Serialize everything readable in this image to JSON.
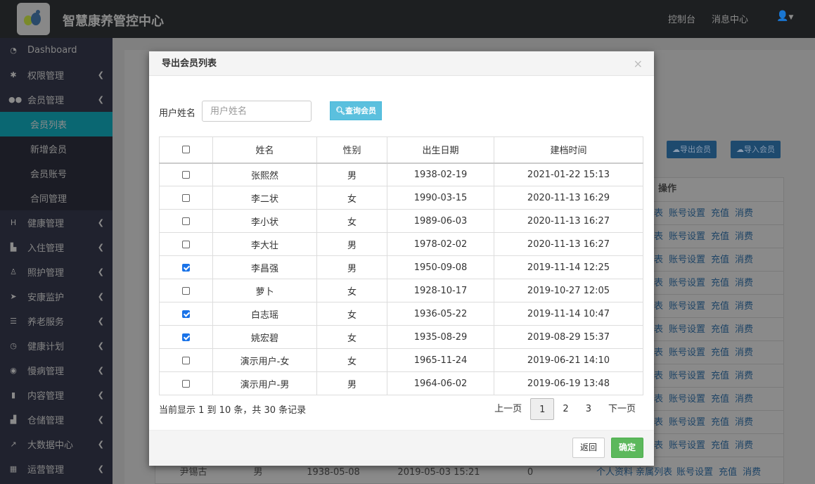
{
  "header": {
    "title": "智慧康养管控中心",
    "links": [
      "控制台",
      "消息中心"
    ],
    "user_icon": "user-icon"
  },
  "sidebar": {
    "items": [
      {
        "label": "Dashboard",
        "icon": "dashboard-icon",
        "glyph": "◔"
      },
      {
        "label": "权限管理",
        "icon": "gear-icon",
        "glyph": "✱"
      },
      {
        "label": "会员管理",
        "icon": "users-icon",
        "glyph": "●●"
      },
      {
        "label": "健康管理",
        "icon": "hospital-icon",
        "glyph": "H"
      },
      {
        "label": "入住管理",
        "icon": "door-icon",
        "glyph": "▙"
      },
      {
        "label": "照护管理",
        "icon": "nurse-icon",
        "glyph": "♙"
      },
      {
        "label": "安康监护",
        "icon": "location-arrow-icon",
        "glyph": "➤"
      },
      {
        "label": "养老服务",
        "icon": "server-icon",
        "glyph": "☰"
      },
      {
        "label": "健康计划",
        "icon": "clock-icon",
        "glyph": "◷"
      },
      {
        "label": "慢病管理",
        "icon": "circle-arrow-icon",
        "glyph": "◉"
      },
      {
        "label": "内容管理",
        "icon": "book-icon",
        "glyph": "▮"
      },
      {
        "label": "仓储管理",
        "icon": "boxes-icon",
        "glyph": "▟"
      },
      {
        "label": "大数据中心",
        "icon": "chart-icon",
        "glyph": "↗"
      },
      {
        "label": "运营管理",
        "icon": "map-icon",
        "glyph": "▦"
      }
    ],
    "submenu": [
      {
        "label": "会员列表",
        "active": true
      },
      {
        "label": "新增会员"
      },
      {
        "label": "会员账号"
      },
      {
        "label": "合同管理"
      }
    ]
  },
  "background": {
    "export_btn": "导出会员",
    "import_btn": "导入会员",
    "ops_header": "操作",
    "row_links": [
      "表",
      "账号设置",
      "充值",
      "消费"
    ],
    "last_row": {
      "name": "尹锡古",
      "gender": "男",
      "birth": "1938-05-08",
      "created": "2019-05-03 15:21",
      "count": "0",
      "links": [
        "个人资料",
        "亲属列表",
        "账号设置",
        "充值",
        "消费"
      ]
    }
  },
  "modal": {
    "title": "导出会员列表",
    "close": "×",
    "search_label": "用户姓名",
    "search_placeholder": "用户姓名",
    "search_btn": "查询会员",
    "columns": [
      "姓名",
      "性别",
      "出生日期",
      "建档时间"
    ],
    "rows": [
      {
        "checked": false,
        "name": "张熙然",
        "gender": "男",
        "birth": "1938-02-19",
        "created": "2021-01-22 15:13"
      },
      {
        "checked": false,
        "name": "李二状",
        "gender": "女",
        "birth": "1990-03-15",
        "created": "2020-11-13 16:29"
      },
      {
        "checked": false,
        "name": "李小状",
        "gender": "女",
        "birth": "1989-06-03",
        "created": "2020-11-13 16:27"
      },
      {
        "checked": false,
        "name": "李大壮",
        "gender": "男",
        "birth": "1978-02-02",
        "created": "2020-11-13 16:27"
      },
      {
        "checked": true,
        "name": "李昌强",
        "gender": "男",
        "birth": "1950-09-08",
        "created": "2019-11-14 12:25"
      },
      {
        "checked": false,
        "name": "萝卜",
        "gender": "女",
        "birth": "1928-10-17",
        "created": "2019-10-27 12:05"
      },
      {
        "checked": true,
        "name": "白志瑶",
        "gender": "女",
        "birth": "1936-05-22",
        "created": "2019-11-14 10:47"
      },
      {
        "checked": true,
        "name": "姚宏碧",
        "gender": "女",
        "birth": "1935-08-29",
        "created": "2019-08-29 15:37"
      },
      {
        "checked": false,
        "name": "演示用户-女",
        "gender": "女",
        "birth": "1965-11-24",
        "created": "2019-06-21 14:10"
      },
      {
        "checked": false,
        "name": "演示用户-男",
        "gender": "男",
        "birth": "1964-06-02",
        "created": "2019-06-19 13:48"
      }
    ],
    "page_info": "当前显示 1 到 10 条，共 30 条记录",
    "pager": {
      "prev": "上一页",
      "pages": [
        "1",
        "2",
        "3"
      ],
      "current": "1",
      "next": "下一页"
    },
    "back_btn": "返回",
    "ok_btn": "确定"
  }
}
